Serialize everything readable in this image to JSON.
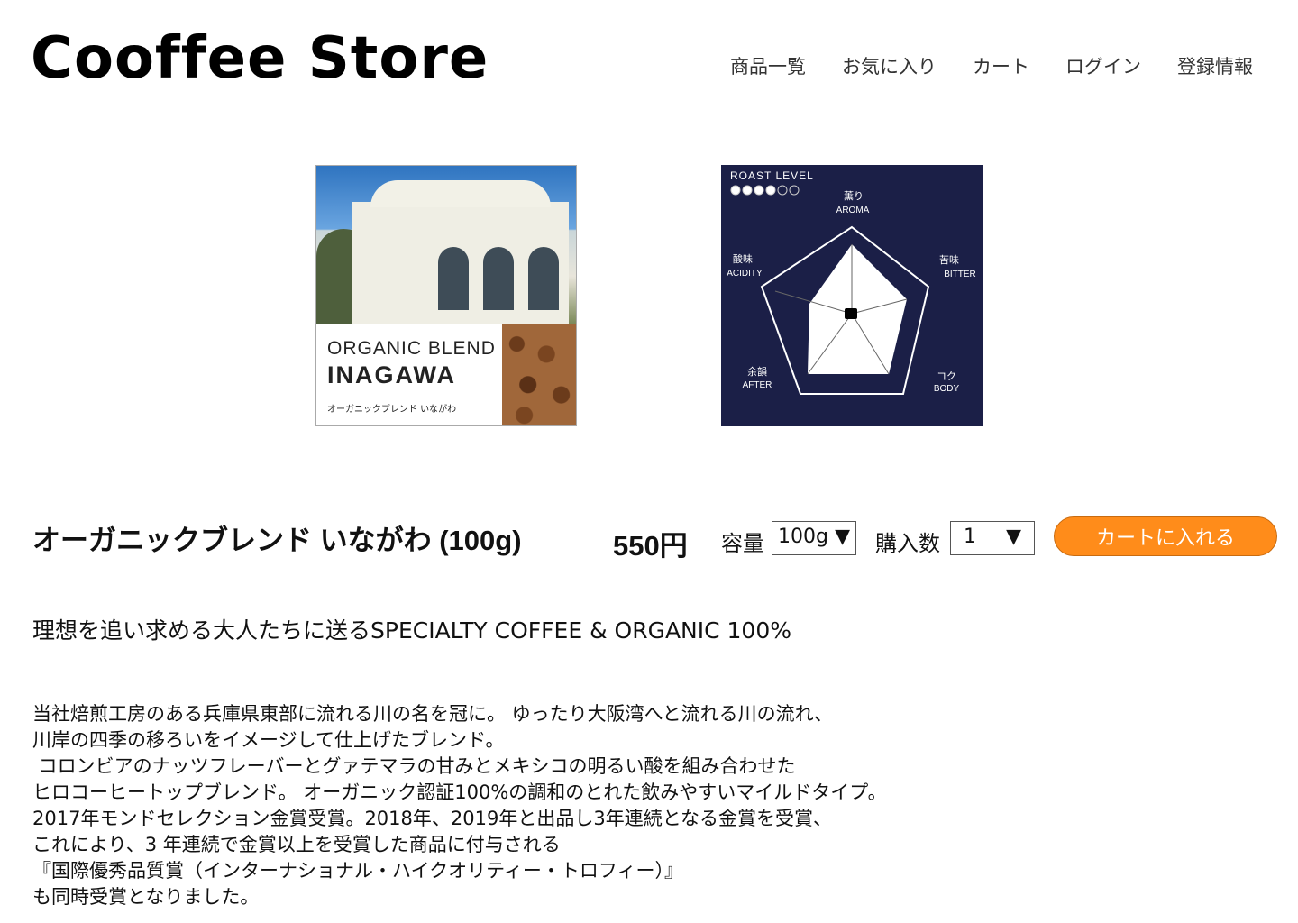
{
  "header": {
    "logo": "Cooffee Store",
    "nav": [
      "商品一覧",
      "お気に入り",
      "カート",
      "ログイン",
      "登録情報"
    ]
  },
  "product_image": {
    "label_en": "ORGANIC BLEND",
    "label_big": "INAGAWA",
    "label_jp": "オーガニックブレンド いながわ"
  },
  "roast_chart": {
    "roast_level_label": "ROAST LEVEL",
    "roast_level": 4,
    "roast_level_max": 6,
    "axes": [
      {
        "jp": "薫り",
        "en": "AROMA"
      },
      {
        "jp": "苦味",
        "en": "BITTER"
      },
      {
        "jp": "コク",
        "en": "BODY"
      },
      {
        "jp": "余韻",
        "en": "AFTER"
      },
      {
        "jp": "酸味",
        "en": "ACIDITY"
      }
    ],
    "colors": {
      "background": "#1b1f47",
      "fill": "#ffffff"
    }
  },
  "product": {
    "title": "オーガニックブレンド いながわ (100g)",
    "price": "550円",
    "capacity_label": "容量",
    "capacity_value": "100g",
    "quantity_label": "購入数",
    "quantity_value": "1",
    "cart_button": "カートに入れる"
  },
  "tagline": "理想を追い求める大人たちに送るSPECIALTY COFFEE & ORGANIC 100%",
  "description": [
    "当社焙煎工房のある兵庫県東部に流れる川の名を冠に。 ゆったり大阪湾へと流れる川の流れ、",
    "川岸の四季の移ろいをイメージして仕上げたブレンド。",
    " コロンビアのナッツフレーバーとグァテマラの甘みとメキシコの明るい酸を組み合わせた",
    "ヒロコーヒートップブレンド。 オーガニック認証100%の調和のとれた飲みやすいマイルドタイプ。",
    "2017年モンドセレクション金賞受賞。2018年、2019年と出品し3年連続となる金賞を受賞、",
    "これにより、3 年連続で金賞以上を受賞した商品に付与される",
    "『国際優秀品質賞（インターナショナル・ハイクオリティー・トロフィー）』",
    "も同時受賞となりました。"
  ],
  "colors": {
    "accent": "#ff8c1a"
  }
}
